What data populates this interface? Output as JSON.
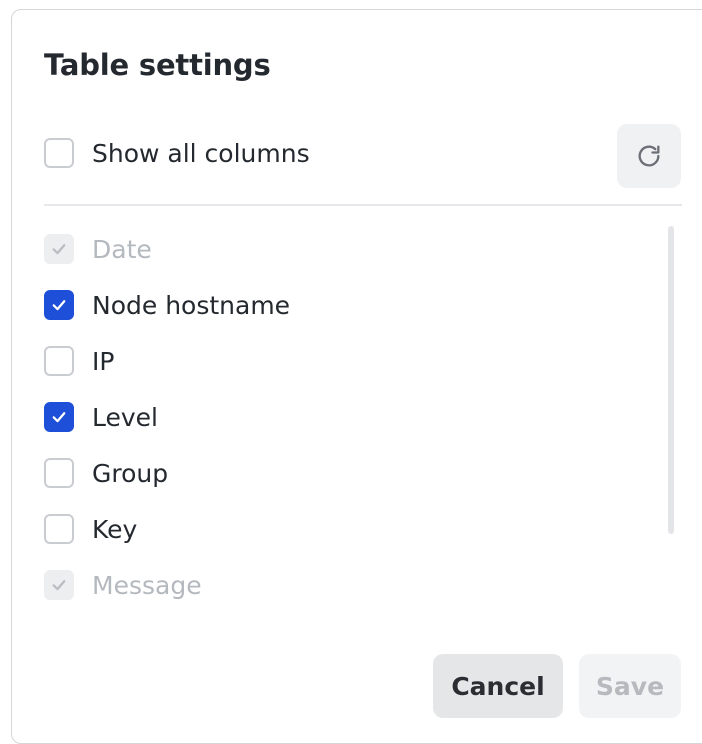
{
  "dialog": {
    "title": "Table settings",
    "show_all": {
      "label": "Show all columns",
      "checked": false
    },
    "reset_icon": "refresh-icon",
    "columns": [
      {
        "label": "Date",
        "state": "checked-disabled"
      },
      {
        "label": "Node hostname",
        "state": "checked"
      },
      {
        "label": "IP",
        "state": "unchecked"
      },
      {
        "label": "Level",
        "state": "checked"
      },
      {
        "label": "Group",
        "state": "unchecked"
      },
      {
        "label": "Key",
        "state": "unchecked"
      },
      {
        "label": "Message",
        "state": "checked-disabled"
      }
    ],
    "cancel_label": "Cancel",
    "save_label": "Save"
  },
  "colors": {
    "accent": "#1e4fd8",
    "text": "#24292f",
    "disabled_text": "#b4b9bf"
  }
}
